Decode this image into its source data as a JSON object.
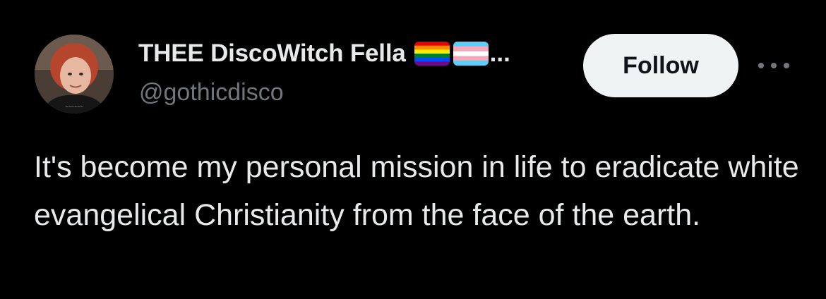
{
  "author": {
    "display_name": "THEE DiscoWitch Fella",
    "name_truncation": "...",
    "handle": "@gothicdisco",
    "flags": [
      "rainbow-flag-icon",
      "transgender-flag-icon"
    ]
  },
  "actions": {
    "follow_label": "Follow"
  },
  "tweet": {
    "text": "It's become my personal mission in life to eradicate white evangelical Christianity from the face of the earth."
  },
  "colors": {
    "background": "#000000",
    "text_primary": "#e7e9ea",
    "text_secondary": "#71767b",
    "follow_bg": "#eff3f4",
    "follow_text": "#0f1419"
  }
}
